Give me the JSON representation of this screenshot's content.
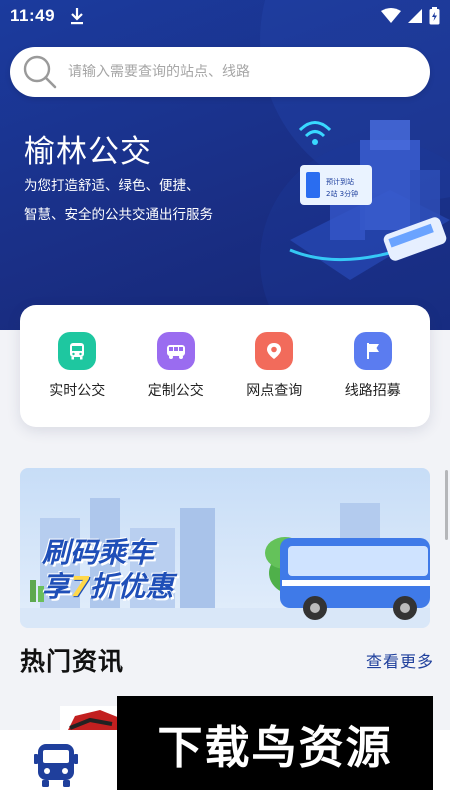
{
  "status_bar": {
    "time": "11:49",
    "icons": [
      "download-icon",
      "wifi-icon",
      "signal-icon",
      "battery-icon"
    ]
  },
  "search": {
    "placeholder": "请输入需要查询的站点、线路",
    "value": ""
  },
  "hero": {
    "title": "榆林公交",
    "subtitle_line1": "为您打造舒适、绿色、便捷、",
    "subtitle_line2": "智慧、安全的公共交通出行服务",
    "illustration_sign_line1": "预计到站",
    "illustration_sign_line2": "2站 3分钟"
  },
  "quick_actions": [
    {
      "label": "实时公交",
      "icon": "bus-icon",
      "color": "#1ec7a0"
    },
    {
      "label": "定制公交",
      "icon": "minibus-icon",
      "color": "#9a6cf0"
    },
    {
      "label": "网点查询",
      "icon": "location-icon",
      "color": "#f26b5b"
    },
    {
      "label": "线路招募",
      "icon": "flag-icon",
      "color": "#5b7cf0"
    }
  ],
  "banner": {
    "line1": "刷码乘车",
    "line2_prefix": "享",
    "line2_number": "7",
    "line2_suffix": "折优惠"
  },
  "news": {
    "title": "热门资讯",
    "more": "查看更多"
  },
  "bottom_nav": {
    "icon": "bus-icon"
  },
  "watermark": {
    "text": "下载鸟资源"
  },
  "colors": {
    "hero_bg": "#1b3b9e",
    "accent": "#1f3f9c",
    "banner_text": "#1f4fb8",
    "banner_highlight": "#ffd84a"
  }
}
